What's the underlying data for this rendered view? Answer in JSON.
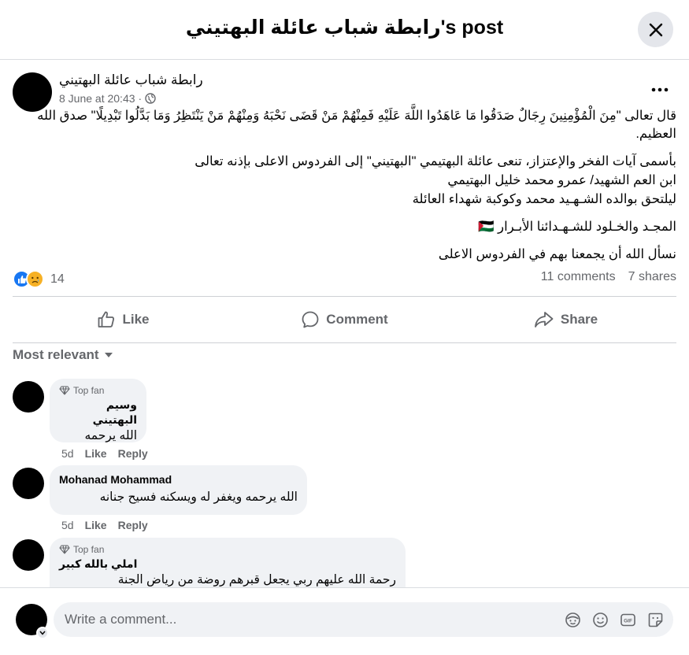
{
  "header": {
    "title": "رابطة شباب عائلة البهتيني's post"
  },
  "post": {
    "author": "رابطة شباب عائلة البهتيني",
    "timestamp": "8 June at 20:43",
    "separator": "·",
    "paragraphs": [
      "قال تعالى \"مِنَ الْمُؤْمِنِينَ رِجَالٌ صَدَقُوا مَا عَاهَدُوا اللَّهَ عَلَيْهِ فَمِنْهُمْ مَنْ قَضَى نَحْبَهُ وَمِنْهُمْ مَنْ يَنْتَظِرُ وَمَا بَدَّلُوا تَبْدِيلًا\" صدق الله العظيم.",
      "بأسمى آيات الفخر والإعتزاز، تنعى عائلة البهتيمي \"البهتيني\" إلى الفردوس الاعلى بإذنه تعالى",
      "ابن العم الشهيد/ عمرو محمد خليل البهتيمي",
      "ليلتحق بوالده الشـهـيد محمد وكوكبة شهداء العائلة",
      "المجـد والخـلود للشـهـدائنا الأبـرار",
      "نسأل الله أن يجمعنا بهم في الفردوس الاعلى"
    ],
    "flag_emoji": "🇵🇸",
    "reaction_count": "14",
    "comments_count": "11 comments",
    "shares_count": "7 shares"
  },
  "actions": {
    "like": "Like",
    "comment": "Comment",
    "share": "Share"
  },
  "sort_label": "Most relevant",
  "comments": [
    {
      "badge": "Top fan",
      "name": "وسيم البهتيني",
      "text": "الله يرحمه",
      "time": "5d",
      "like": "Like",
      "reply": "Reply"
    },
    {
      "name": "Mohanad Mohammad",
      "text": "الله يرحمه ويغفر له ويسكنه فسيح جنانه",
      "time": "5d",
      "like": "Like",
      "reply": "Reply"
    },
    {
      "badge": "Top fan",
      "name": "املي بالله كبير",
      "text": "رحمة الله عليهم ربي يجعل قبرهم روضة من رياض الجنة"
    }
  ],
  "composer": {
    "placeholder": "Write a comment..."
  },
  "colors": {
    "accent": "#1877f2",
    "sad": "#f7b125",
    "muted": "#65676b",
    "bubble": "#f0f2f5"
  }
}
